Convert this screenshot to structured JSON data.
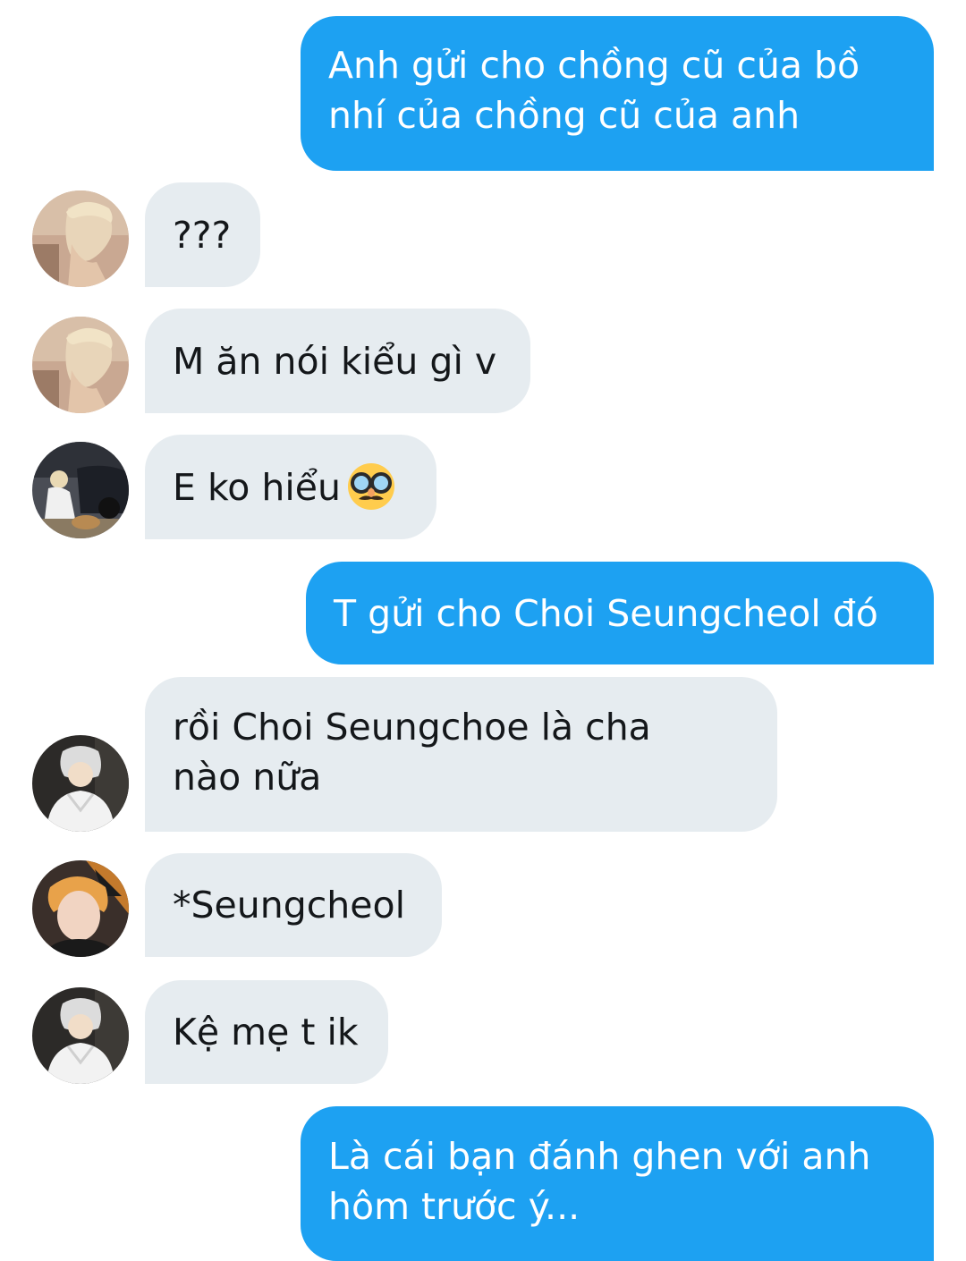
{
  "conversation": {
    "messages": [
      {
        "direction": "outgoing",
        "text_lines": [
          "Anh gửi cho chồng cũ của bồ",
          "nhí của chồng cũ của anh"
        ]
      },
      {
        "direction": "incoming",
        "sender_avatar": "avatar-blonde-profile",
        "text": "???"
      },
      {
        "direction": "incoming",
        "sender_avatar": "avatar-blonde-profile",
        "text": "M ăn nói kiểu gì v"
      },
      {
        "direction": "incoming",
        "sender_avatar": "avatar-crouching-car",
        "text": "E ko hiểu",
        "emoji": "disguised-face-emoji"
      },
      {
        "direction": "outgoing",
        "text": "T gửi cho Choi Seungcheol đó"
      },
      {
        "direction": "incoming",
        "sender_avatar": "avatar-white-hoodie",
        "text_lines": [
          "rồi Choi Seungchoe là cha",
          "nào nữa"
        ]
      },
      {
        "direction": "incoming",
        "sender_avatar": "avatar-orange-hair",
        "text": "*Seungcheol"
      },
      {
        "direction": "incoming",
        "sender_avatar": "avatar-white-hoodie",
        "text": "Kệ mẹ t ik"
      },
      {
        "direction": "outgoing",
        "text_lines": [
          "Là cái bạn đánh ghen với anh",
          "hôm trước ý..."
        ]
      }
    ]
  },
  "colors": {
    "outgoing_bubble": "#1da1f2",
    "incoming_bubble": "#e6ecf0",
    "outgoing_text": "#ffffff",
    "incoming_text": "#14171a",
    "background": "#ffffff"
  }
}
